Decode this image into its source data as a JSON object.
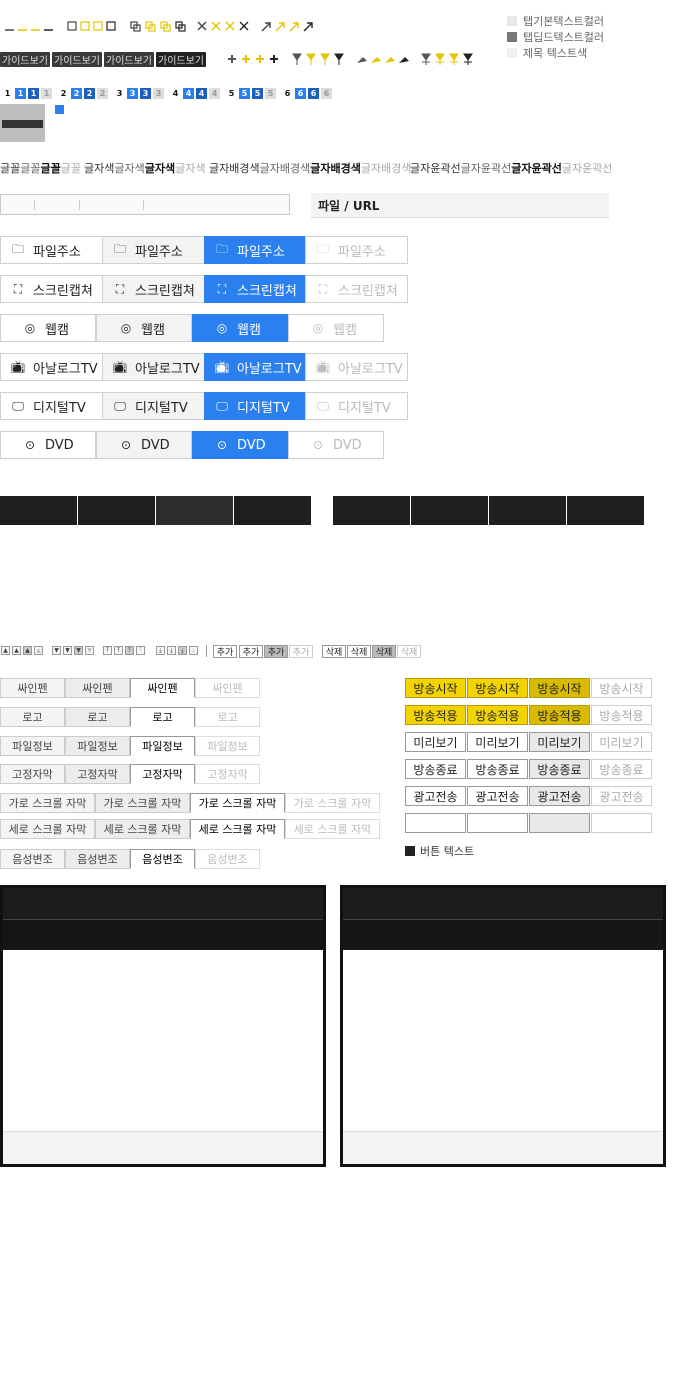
{
  "legend": {
    "tab_default_text_color": "탭기본텍스트컬러",
    "tab_selected_text_color": "탭딥드텍스트컬러",
    "title_text_color": "제목 텍스트색"
  },
  "guide_buttons": [
    "가이드보기",
    "가이드보기",
    "가이드보기",
    "가이드보기"
  ],
  "numbers": [
    "1",
    "1",
    "1",
    "1",
    "2",
    "2",
    "2",
    "2",
    "3",
    "3",
    "3",
    "3",
    "4",
    "4",
    "4",
    "4",
    "5",
    "5",
    "5",
    "5",
    "6",
    "6",
    "6",
    "6"
  ],
  "text_formats": {
    "font": [
      "글꼴",
      "글꼴",
      "글꼴",
      "글꼴"
    ],
    "font_color": [
      "글자색",
      "글자색",
      "글자색",
      "글자색"
    ],
    "font_bg": [
      "글자배경색",
      "글자배경색",
      "글자배경색",
      "글자배경색"
    ],
    "font_outline": [
      "글자윤곽선",
      "글자윤곽선",
      "글자윤곽선",
      "글자윤곽선"
    ]
  },
  "file_url_label": "파일 / URL",
  "source_buttons": {
    "file": "파일주소",
    "screen": "스크린캡쳐",
    "webcam": "웹캠",
    "analog": "아날로그TV",
    "digital": "디지털TV",
    "dvd": "DVD"
  },
  "small_buttons": {
    "add": "추가",
    "delete": "삭제"
  },
  "tabs": {
    "sign_pen": "싸인펜",
    "logo": "로고",
    "file_info": "파일정보",
    "fixed_caption": "고정자막",
    "h_scroll_caption": "가로 스크롤 자막",
    "v_scroll_caption": "세로 스크롤 자막",
    "voice_mod": "음성변조"
  },
  "right_buttons": {
    "start": "방송시작",
    "apply": "방송적용",
    "preview": "미리보기",
    "end": "방송종료",
    "ad": "광고전송",
    "button_text": "버튼 텍스트"
  },
  "colors": {
    "accent": "#2b80f0",
    "yellow": "#f3d400",
    "dark": "#1e1e1e"
  }
}
